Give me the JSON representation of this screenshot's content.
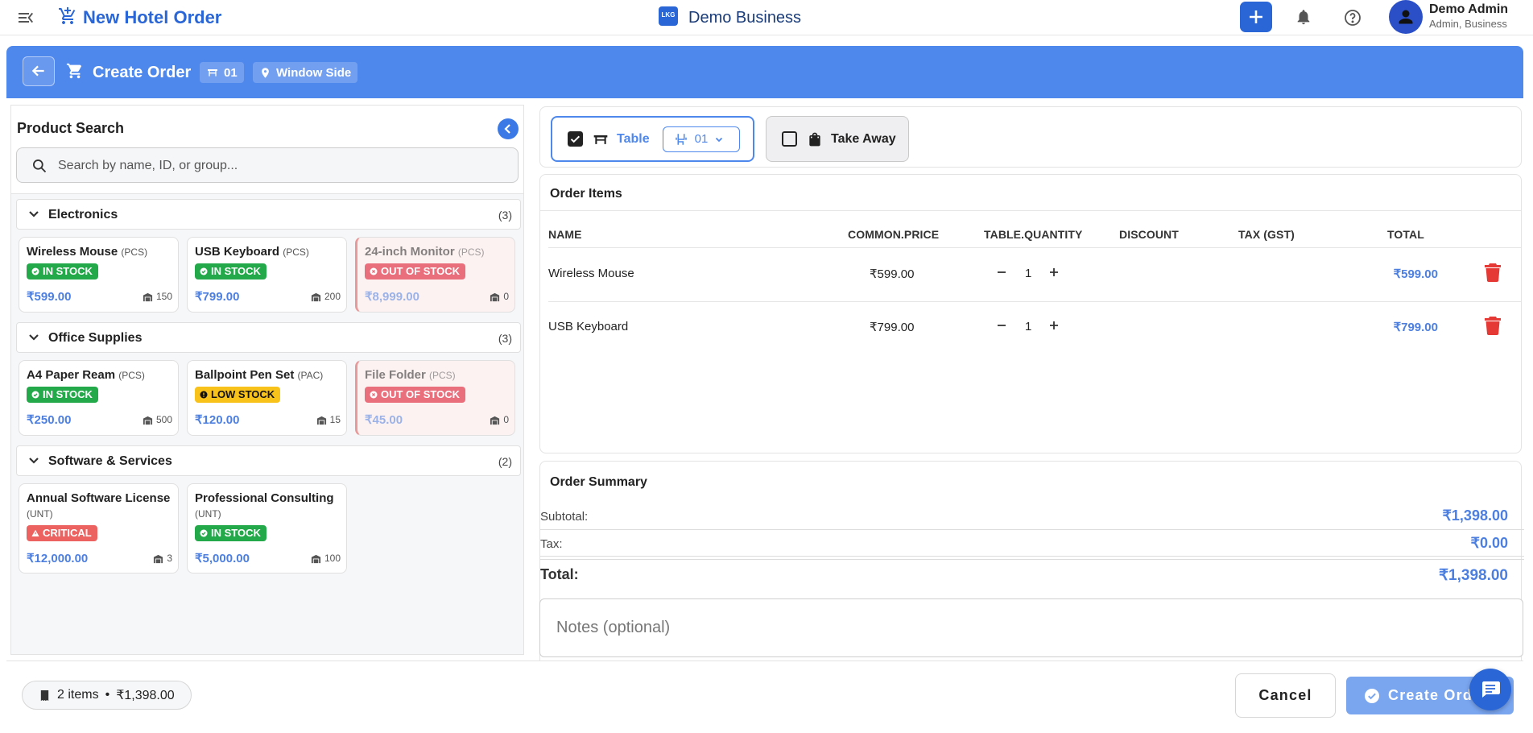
{
  "topbar": {
    "title": "New Hotel Order",
    "logo_text": "LKG",
    "brand": "Demo Business",
    "user_name": "Demo Admin",
    "user_role": "Admin, Business"
  },
  "header": {
    "title": "Create Order",
    "table_chip": "01",
    "location_chip": "Window Side"
  },
  "product_search": {
    "title": "Product Search",
    "placeholder": "Search by name, ID, or group...",
    "categories": [
      {
        "name": "Electronics",
        "count": "(3)",
        "products": [
          {
            "name": "Wireless Mouse",
            "unit": "(PCS)",
            "status": "IN STOCK",
            "price": "₹599.00",
            "stock": "150"
          },
          {
            "name": "USB Keyboard",
            "unit": "(PCS)",
            "status": "IN STOCK",
            "price": "₹799.00",
            "stock": "200"
          },
          {
            "name": "24-inch Monitor",
            "unit": "(PCS)",
            "status": "OUT OF STOCK",
            "price": "₹8,999.00",
            "stock": "0"
          }
        ]
      },
      {
        "name": "Office Supplies",
        "count": "(3)",
        "products": [
          {
            "name": "A4 Paper Ream",
            "unit": "(PCS)",
            "status": "IN STOCK",
            "price": "₹250.00",
            "stock": "500"
          },
          {
            "name": "Ballpoint Pen Set",
            "unit": "(PAC)",
            "status": "LOW STOCK",
            "price": "₹120.00",
            "stock": "15"
          },
          {
            "name": "File Folder",
            "unit": "(PCS)",
            "status": "OUT OF STOCK",
            "price": "₹45.00",
            "stock": "0"
          }
        ]
      },
      {
        "name": "Software & Services",
        "count": "(2)",
        "products": [
          {
            "name": "Annual Software License",
            "unit": "(UNT)",
            "status": "CRITICAL",
            "price": "₹12,000.00",
            "stock": "3"
          },
          {
            "name": "Professional Consulting",
            "unit": "(UNT)",
            "status": "IN STOCK",
            "price": "₹5,000.00",
            "stock": "100"
          }
        ]
      }
    ]
  },
  "order_type": {
    "table_label": "Table",
    "table_checked": true,
    "table_value": "01",
    "takeaway_label": "Take Away",
    "takeaway_checked": false
  },
  "order_items": {
    "title": "Order Items",
    "columns": [
      "NAME",
      "COMMON.PRICE",
      "TABLE.QUANTITY",
      "DISCOUNT",
      "TAX (GST)",
      "TOTAL"
    ],
    "rows": [
      {
        "name": "Wireless Mouse",
        "price": "₹599.00",
        "qty": "1",
        "discount": "",
        "tax": "",
        "total": "₹599.00"
      },
      {
        "name": "USB Keyboard",
        "price": "₹799.00",
        "qty": "1",
        "discount": "",
        "tax": "",
        "total": "₹799.00"
      }
    ]
  },
  "order_summary": {
    "title": "Order Summary",
    "subtotal_label": "Subtotal:",
    "subtotal": "₹1,398.00",
    "tax_label": "Tax:",
    "tax": "₹0.00",
    "total_label": "Total:",
    "total": "₹1,398.00",
    "notes_placeholder": "Notes (optional)"
  },
  "footer": {
    "items_count": "2 items",
    "separator": "•",
    "items_total": "₹1,398.00",
    "cancel_label": "Cancel",
    "create_label": "Create Order"
  },
  "colors": {
    "primary": "#2a66d6",
    "header_bg": "#4f88ec",
    "in_stock": "#23a94a",
    "low_stock": "#f9c21a",
    "out_of_stock": "#ea6f7c",
    "critical": "#ec6260",
    "delete": "#e53935"
  }
}
